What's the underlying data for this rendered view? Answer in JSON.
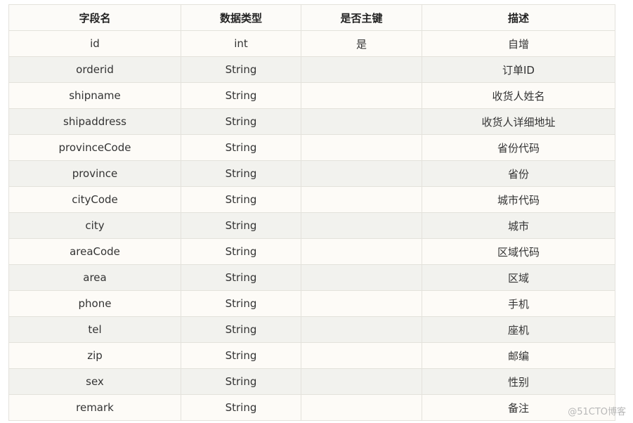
{
  "table": {
    "headers": [
      "字段名",
      "数据类型",
      "是否主键",
      "描述"
    ],
    "rows": [
      [
        "id",
        "int",
        "是",
        "自增"
      ],
      [
        "orderid",
        "String",
        "",
        "订单ID"
      ],
      [
        "shipname",
        "String",
        "",
        "收货人姓名"
      ],
      [
        "shipaddress",
        "String",
        "",
        "收货人详细地址"
      ],
      [
        "provinceCode",
        "String",
        "",
        "省份代码"
      ],
      [
        "province",
        "String",
        "",
        "省份"
      ],
      [
        "cityCode",
        "String",
        "",
        "城市代码"
      ],
      [
        "city",
        "String",
        "",
        "城市"
      ],
      [
        "areaCode",
        "String",
        "",
        "区域代码"
      ],
      [
        "area",
        "String",
        "",
        "区域"
      ],
      [
        "phone",
        "String",
        "",
        "手机"
      ],
      [
        "tel",
        "String",
        "",
        "座机"
      ],
      [
        "zip",
        "String",
        "",
        "邮编"
      ],
      [
        "sex",
        "String",
        "",
        "性别"
      ],
      [
        "remark",
        "String",
        "",
        "备注"
      ]
    ]
  },
  "watermark": "@51CTO博客"
}
